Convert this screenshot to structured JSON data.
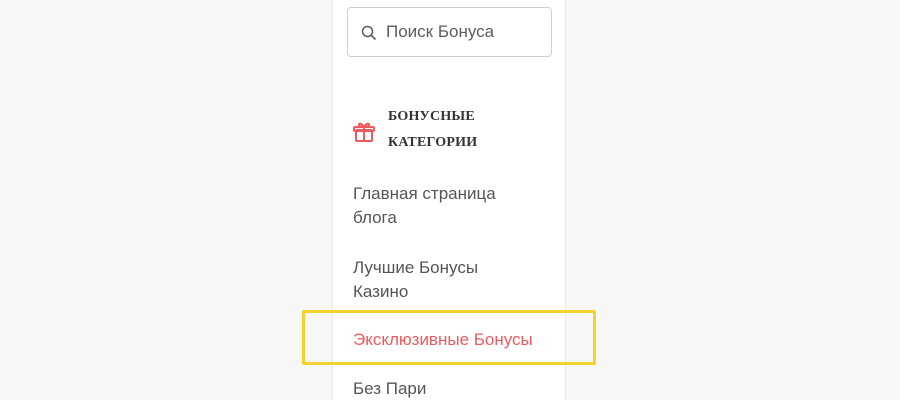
{
  "search": {
    "placeholder": "Поиск Бонуса",
    "icon": "search-icon"
  },
  "category": {
    "icon": "gift-icon",
    "title_line_1": "БОНУСНЫЕ",
    "title_line_2": "КАТЕГОРИИ"
  },
  "links": [
    {
      "line_1": "Главная страница",
      "line_2": "блога"
    },
    {
      "line_1": "Лучшие Бонусы",
      "line_2": "Казино"
    },
    {
      "label": "Эксклюзивные Бонусы",
      "active": true
    },
    {
      "label": "Без Пари"
    }
  ],
  "colors": {
    "background": "#f7f7f5",
    "panel": "#ffffff",
    "text": "#555555",
    "active_link": "#ee5a5e",
    "highlight": "#f3d12f"
  }
}
